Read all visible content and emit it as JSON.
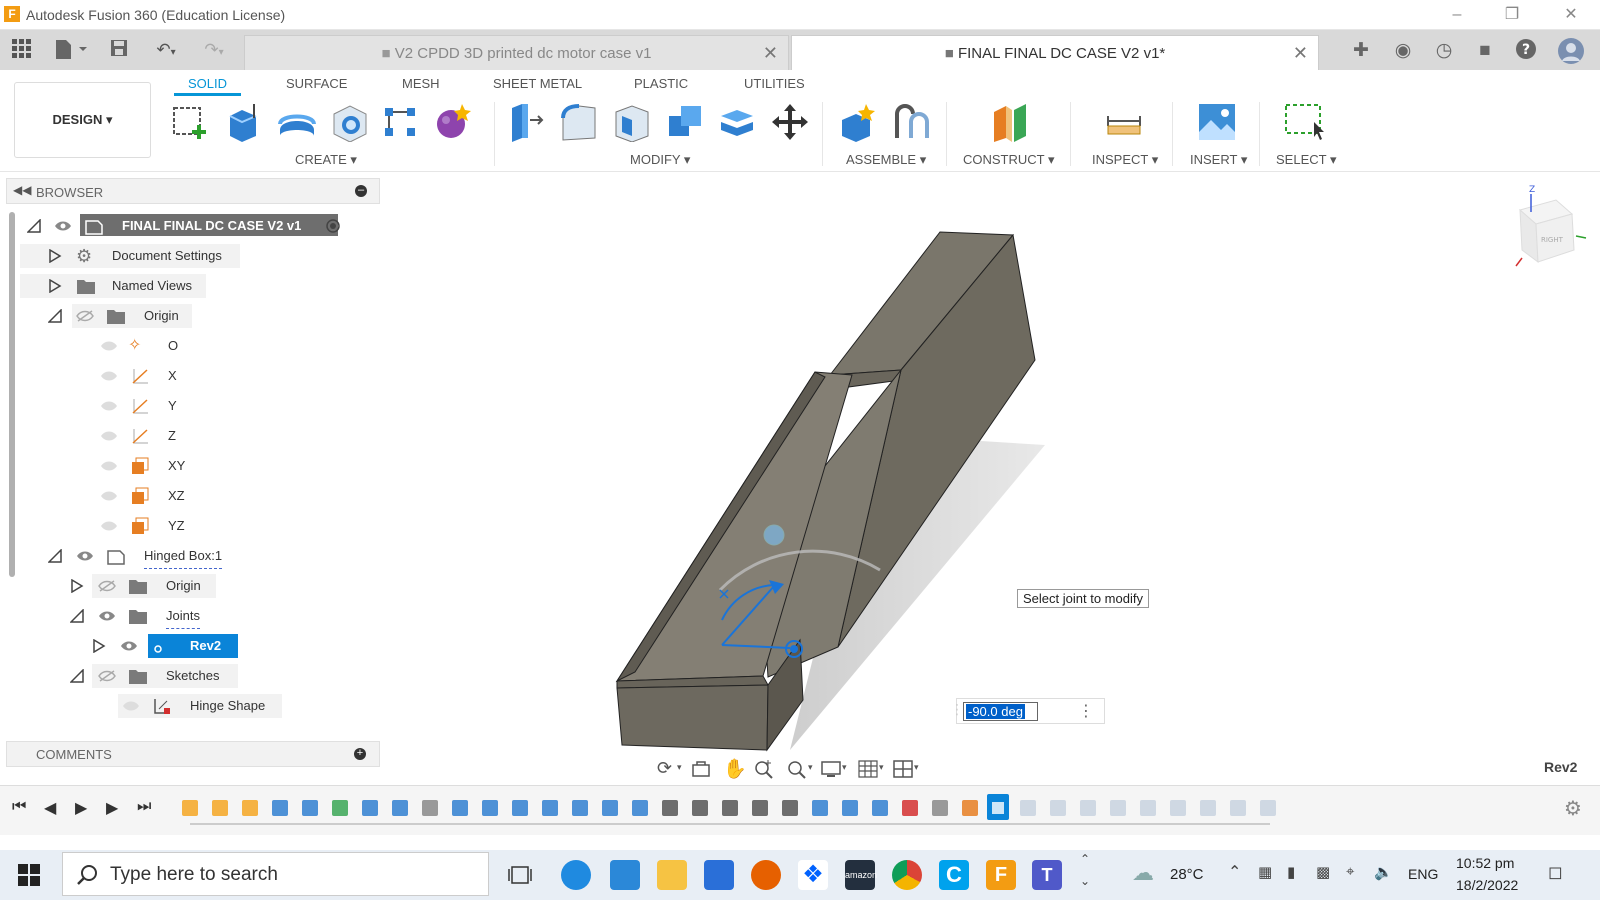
{
  "window": {
    "title": "Autodesk Fusion 360 (Education License)"
  },
  "tabs": [
    {
      "label": "V2 CPDD 3D printed dc motor case v1",
      "active": false
    },
    {
      "label": "FINAL FINAL DC CASE V2 v1*",
      "active": true
    }
  ],
  "ribbon": {
    "workspace": "DESIGN ▾",
    "tabs": [
      "SOLID",
      "SURFACE",
      "MESH",
      "SHEET METAL",
      "PLASTIC",
      "UTILITIES"
    ],
    "groups": {
      "create": "CREATE ▾",
      "modify": "MODIFY ▾",
      "assemble": "ASSEMBLE ▾",
      "construct": "CONSTRUCT ▾",
      "inspect": "INSPECT ▾",
      "insert": "INSERT ▾",
      "select": "SELECT ▾"
    }
  },
  "browser": {
    "title": "BROWSER",
    "root": "FINAL FINAL DC CASE V2 v1",
    "items": {
      "document_settings": "Document Settings",
      "named_views": "Named Views",
      "origin": "Origin",
      "o": "O",
      "x": "X",
      "y": "Y",
      "z": "Z",
      "xy": "XY",
      "xz": "XZ",
      "yz": "YZ",
      "hinged_box": "Hinged Box:1",
      "hb_origin": "Origin",
      "joints": "Joints",
      "rev2": "Rev2",
      "sketches": "Sketches",
      "hinge_shape": "Hinge Shape"
    }
  },
  "comments": {
    "title": "COMMENTS"
  },
  "viewport": {
    "tooltip": "Select joint to modify",
    "angle_value": "-90.0 deg",
    "selection_label": "Rev2",
    "viewcube_face": "RIGHT"
  },
  "taskbar": {
    "search_placeholder": "Type here to search",
    "weather": "28°C",
    "language": "ENG",
    "time": "10:52 pm",
    "date": "18/2/2022"
  },
  "colors": {
    "accent": "#0696d7",
    "selection": "#0a84d8",
    "model": "#6e6a5f"
  }
}
